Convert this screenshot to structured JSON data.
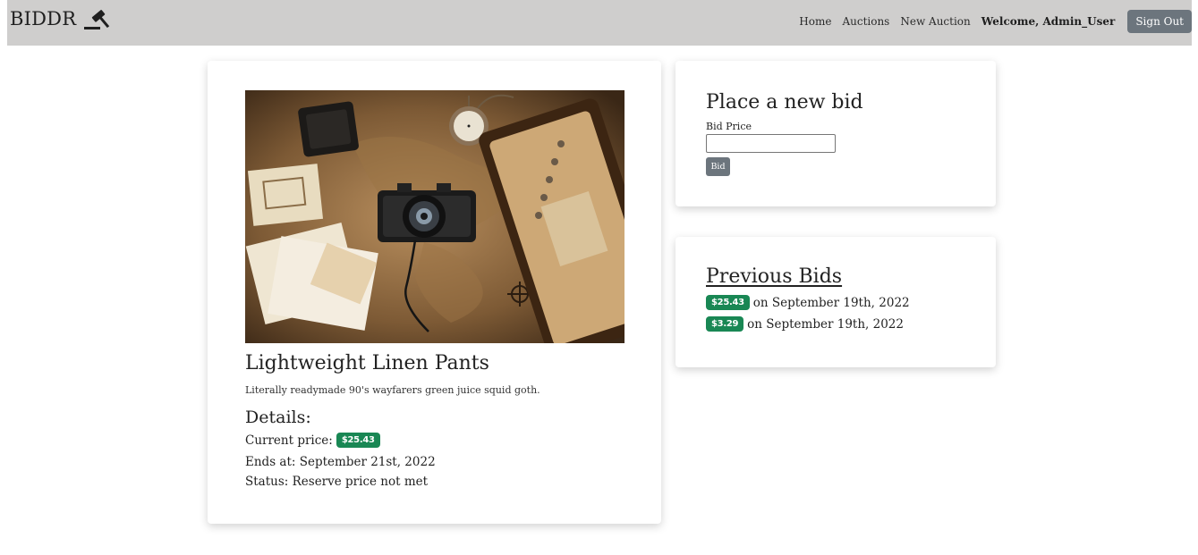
{
  "navbar": {
    "brand": "BIDDR",
    "brand_icon": "gavel-icon",
    "links": [
      "Home",
      "Auctions",
      "New Auction"
    ],
    "welcome": "Welcome, Admin_User",
    "signout_label": "Sign Out"
  },
  "item": {
    "title": "Lightweight Linen Pants",
    "description": "Literally readymade 90's wayfarers green juice squid goth.",
    "details_heading": "Details:",
    "current_price_label": "Current price:",
    "current_price": "$25.43",
    "ends_at": "Ends at: September 21st, 2022",
    "status": "Status: Reserve price not met"
  },
  "bid_form": {
    "heading": "Place a new bid",
    "label": "Bid Price",
    "input_value": "",
    "button_label": "Bid"
  },
  "previous_bids": {
    "heading": "Previous Bids",
    "bids": [
      {
        "amount": "$25.43",
        "date": "on September 19th, 2022"
      },
      {
        "amount": "$3.29",
        "date": "on September 19th, 2022"
      }
    ]
  },
  "colors": {
    "navbar_bg": "#cfcecd",
    "badge_green": "#198754",
    "button_gray": "#6c757d"
  }
}
